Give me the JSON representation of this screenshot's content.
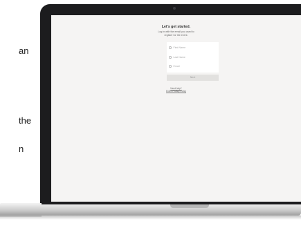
{
  "side_text": [
    "an",
    "the",
    "n"
  ],
  "page": {
    "heading": "Let's get started.",
    "subtext_line1": "Log in with the email you used to",
    "subtext_line2": "register for the event.",
    "fields": [
      {
        "label": "First Name"
      },
      {
        "label": "Last Name"
      },
      {
        "label": "Email"
      }
    ],
    "next_button": "Next",
    "footer_link1": "Need help?",
    "footer_link2": "Event Privacy Policy"
  }
}
